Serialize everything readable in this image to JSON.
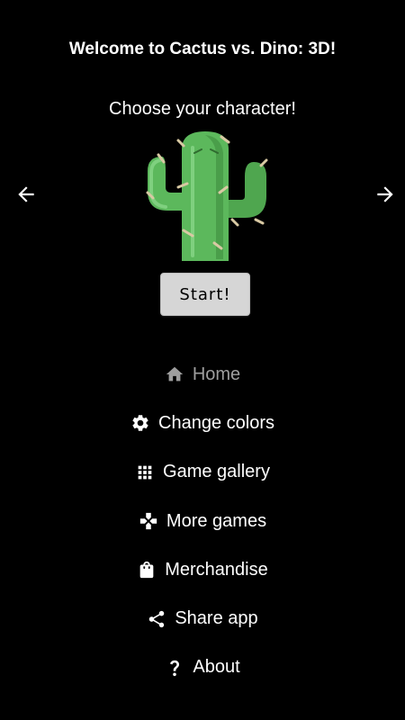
{
  "header": {
    "title": "Welcome to Cactus vs. Dino: 3D!",
    "subtitle": "Choose your character!"
  },
  "character": {
    "name": "cactus",
    "icon": "cactus-icon",
    "prev_icon": "arrow-left-icon",
    "next_icon": "arrow-right-icon"
  },
  "start_button": {
    "label": "Start!"
  },
  "menu": {
    "items": [
      {
        "label": "Home",
        "icon": "home-icon",
        "active": true
      },
      {
        "label": "Change colors",
        "icon": "gear-icon",
        "active": false
      },
      {
        "label": "Game gallery",
        "icon": "grid-icon",
        "active": false
      },
      {
        "label": "More games",
        "icon": "gamepad-icon",
        "active": false
      },
      {
        "label": "Merchandise",
        "icon": "shopping-bag-icon",
        "active": false
      },
      {
        "label": "Share app",
        "icon": "share-icon",
        "active": false
      },
      {
        "label": "About",
        "icon": "question-icon",
        "active": false
      }
    ]
  },
  "colors": {
    "background": "#000000",
    "text": "#ffffff",
    "active_menu_text": "#9e9e9e",
    "cactus_green": "#5cb85c",
    "start_button_bg": "#d6d6d6"
  }
}
